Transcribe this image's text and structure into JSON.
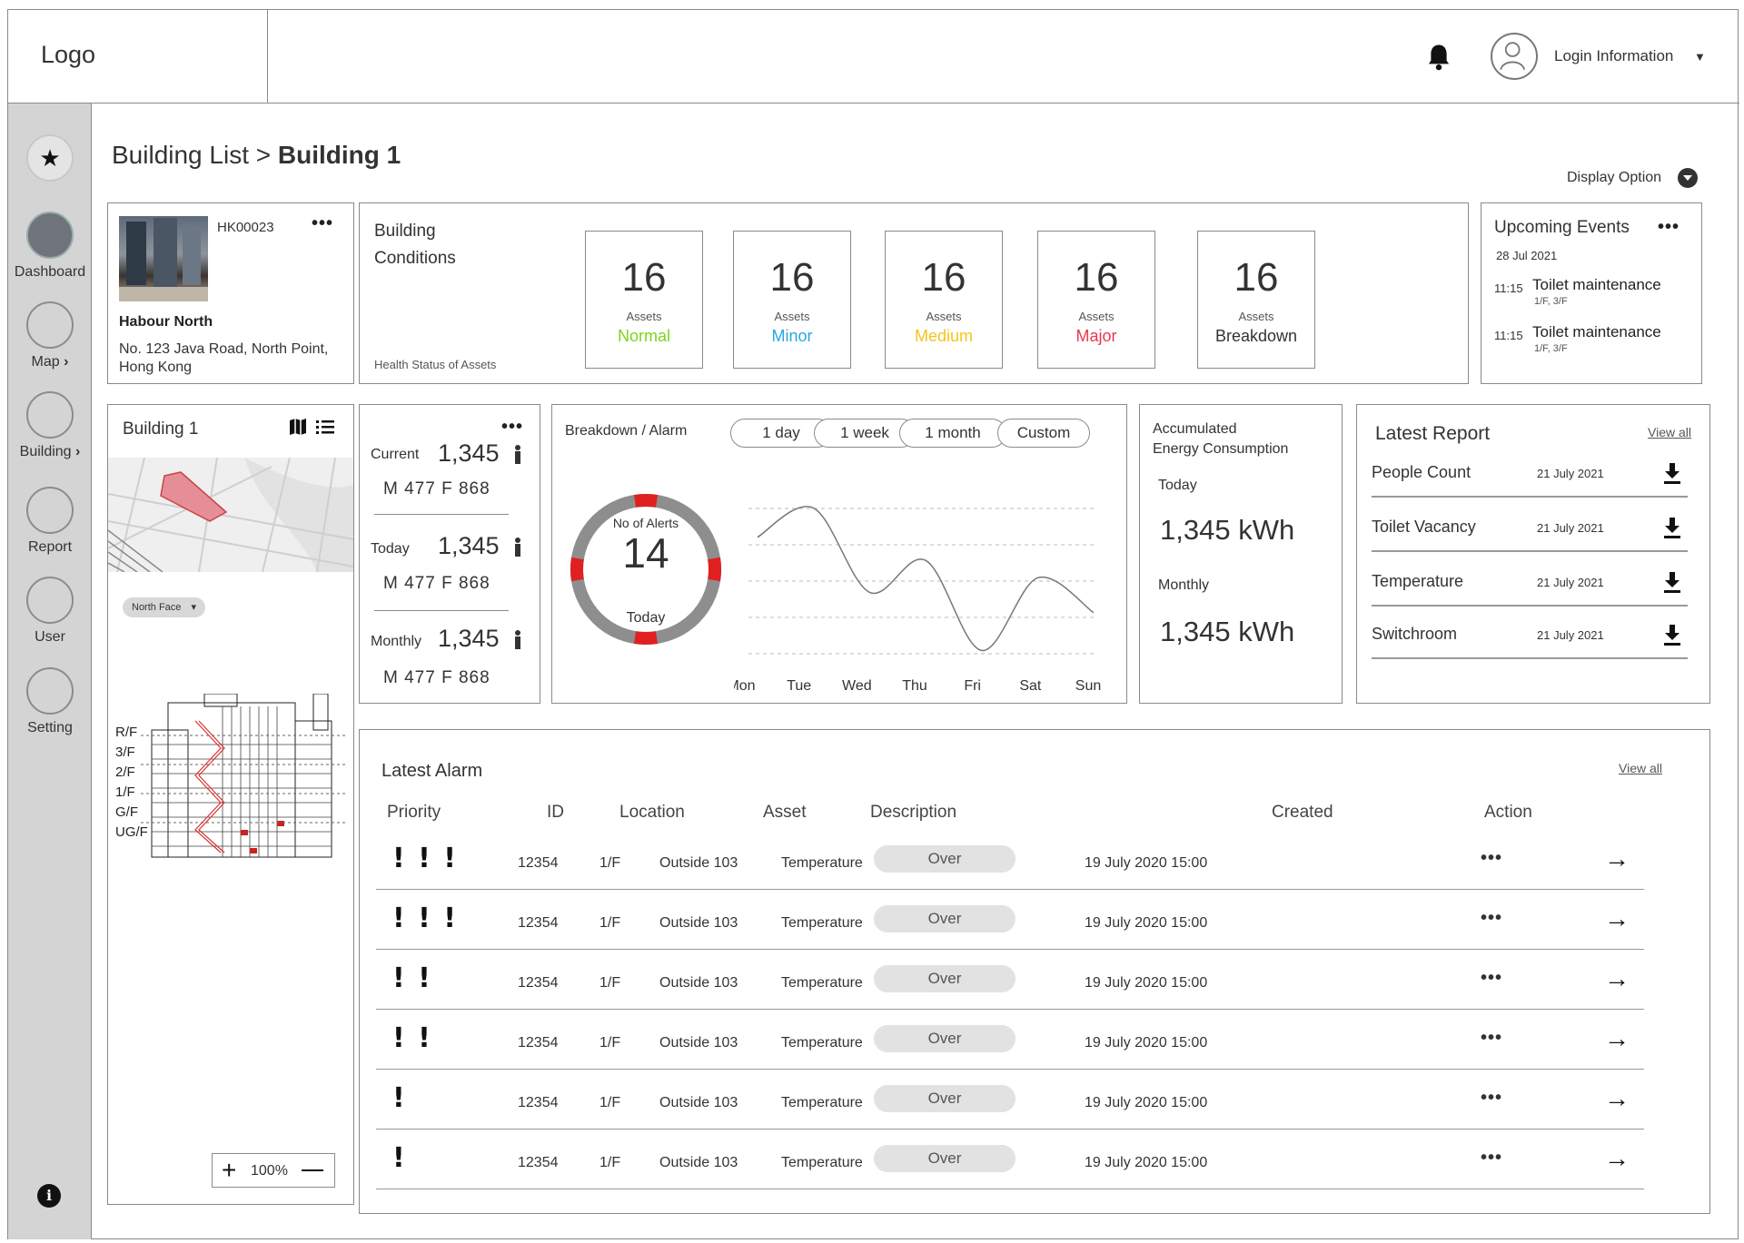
{
  "header": {
    "logo": "Logo",
    "login_label": "Login Information",
    "caret": "▼"
  },
  "sidebar": {
    "items": [
      {
        "label": "",
        "icon": "star-icon"
      },
      {
        "label": "Dashboard",
        "icon": "dashboard-icon"
      },
      {
        "label": "Map",
        "icon": "map-icon"
      },
      {
        "label": "Building",
        "icon": "building-icon"
      },
      {
        "label": "Report",
        "icon": "report-icon"
      },
      {
        "label": "User",
        "icon": "user-icon"
      },
      {
        "label": "Setting",
        "icon": "setting-icon"
      }
    ]
  },
  "page": {
    "breadcrumb_parent": "Building List > ",
    "breadcrumb_current": "Building 1",
    "display_option": "Display Option"
  },
  "building_info": {
    "code": "HK00023",
    "name": "Habour North",
    "address_line1": "No. 123 Java Road, North Point,",
    "address_line2": "Hong Kong"
  },
  "conditions": {
    "title_line1": "Building",
    "title_line2": "Conditions",
    "footnote": "Health Status of Assets",
    "items": [
      {
        "count": "16",
        "label": "Assets",
        "status": "Normal",
        "color": "#7ed321"
      },
      {
        "count": "16",
        "label": "Assets",
        "status": "Minor",
        "color": "#29a8e0"
      },
      {
        "count": "16",
        "label": "Assets",
        "status": "Medium",
        "color": "#f5c518"
      },
      {
        "count": "16",
        "label": "Assets",
        "status": "Major",
        "color": "#e8384f"
      },
      {
        "count": "16",
        "label": "Assets",
        "status": "Breakdown",
        "color": "#333333"
      }
    ]
  },
  "events": {
    "title": "Upcoming Events",
    "date": "28 Jul 2021",
    "items": [
      {
        "time": "11:15",
        "title": "Toilet maintenance",
        "location": "1/F, 3/F"
      },
      {
        "time": "11:15",
        "title": "Toilet maintenance",
        "location": "1/F, 3/F"
      }
    ]
  },
  "map_panel": {
    "title": "Building 1",
    "face_selector": "North Face",
    "floors": [
      "R/F",
      "3/F",
      "2/F",
      "1/F",
      "G/F",
      "UG/F"
    ],
    "zoom": "100%"
  },
  "occupancy": {
    "rows": [
      {
        "label": "Current",
        "value": "1,345",
        "mf": "M  477  F  868"
      },
      {
        "label": "Today",
        "value": "1,345",
        "mf": "M  477  F  868"
      },
      {
        "label": "Monthly",
        "value": "1,345",
        "mf": "M  477  F  868"
      }
    ]
  },
  "alarm_chart": {
    "title": "Breakdown / Alarm",
    "ranges": [
      "1 day",
      "1 week",
      "1 month",
      "Custom"
    ],
    "gauge_label": "No of Alerts",
    "gauge_value": "14",
    "gauge_sub": "Today",
    "accent": "#e02020"
  },
  "chart_data": {
    "type": "line",
    "categories": [
      "Mon",
      "Tue",
      "Wed",
      "Thu",
      "Fri",
      "Sat",
      "Sun"
    ],
    "series": [
      {
        "values": [
          4.2,
          5.2,
          2.3,
          3.4,
          0.3,
          2.8,
          1.6
        ]
      }
    ],
    "ylim": [
      0,
      5.5
    ],
    "grid": true,
    "xlabel": "",
    "ylabel": ""
  },
  "energy": {
    "title_line1": "Accumulated",
    "title_line2": "Energy Consumption",
    "today_label": "Today",
    "today_value": "1,345 kWh",
    "monthly_label": "Monthly",
    "monthly_value": "1,345 kWh"
  },
  "reports": {
    "title": "Latest Report",
    "view_all": "View all",
    "items": [
      {
        "name": "People Count",
        "date": "21 July 2021"
      },
      {
        "name": "Toilet Vacancy",
        "date": "21 July 2021"
      },
      {
        "name": "Temperature",
        "date": "21 July 2021"
      },
      {
        "name": "Switchroom",
        "date": "21 July 2021"
      }
    ]
  },
  "alarms": {
    "title": "Latest Alarm",
    "view_all": "View all",
    "columns": [
      "Priority",
      "ID",
      "Location",
      "Asset",
      "Description",
      "Created",
      "Action"
    ],
    "rows": [
      {
        "priority": "! ! !",
        "id": "12354",
        "location": "1/F",
        "asset": "Outside 103",
        "description": "Temperature",
        "status": "Over",
        "created": "19 July 2020  15:00"
      },
      {
        "priority": "! ! !",
        "id": "12354",
        "location": "1/F",
        "asset": "Outside 103",
        "description": "Temperature",
        "status": "Over",
        "created": "19 July 2020  15:00"
      },
      {
        "priority": "!  !",
        "id": "12354",
        "location": "1/F",
        "asset": "Outside 103",
        "description": "Temperature",
        "status": "Over",
        "created": "19 July 2020  15:00"
      },
      {
        "priority": "!  !",
        "id": "12354",
        "location": "1/F",
        "asset": "Outside 103",
        "description": "Temperature",
        "status": "Over",
        "created": "19 July 2020  15:00"
      },
      {
        "priority": "!",
        "id": "12354",
        "location": "1/F",
        "asset": "Outside 103",
        "description": "Temperature",
        "status": "Over",
        "created": "19 July 2020  15:00"
      },
      {
        "priority": "!",
        "id": "12354",
        "location": "1/F",
        "asset": "Outside 103",
        "description": "Temperature",
        "status": "Over",
        "created": "19 July 2020  15:00"
      }
    ]
  }
}
